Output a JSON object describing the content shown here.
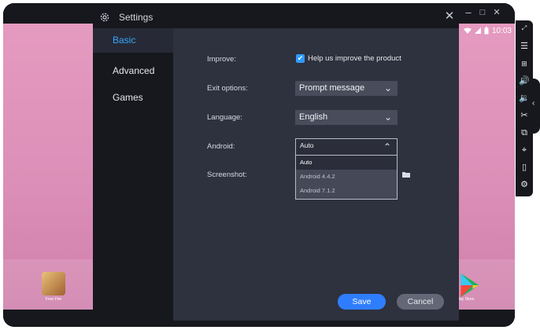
{
  "window": {
    "minimize_glyph": "–",
    "maximize_glyph": "□",
    "close_glyph": "✕"
  },
  "android": {
    "clock": "10:03",
    "apps": [
      {
        "label": "Free Fire"
      },
      {
        "label": "Play Store"
      }
    ]
  },
  "dialog": {
    "title": "Settings",
    "close_glyph": "✕",
    "nav": [
      {
        "label": "Basic",
        "active": true
      },
      {
        "label": "Advanced",
        "active": false
      },
      {
        "label": "Games",
        "active": false
      }
    ],
    "improve": {
      "label": "Improve:",
      "checkbox_label": "Help us improve the product",
      "checked": true
    },
    "exit_options": {
      "label": "Exit options:",
      "value": "Prompt message"
    },
    "language": {
      "label": "Language:",
      "value": "English"
    },
    "android_version": {
      "label": "Android:",
      "value": "Auto",
      "options": [
        "Auto",
        "Android 4.4.2",
        "Android 7.1.2"
      ]
    },
    "screenshot": {
      "label": "Screenshot:"
    },
    "save_label": "Save",
    "cancel_label": "Cancel"
  },
  "colors": {
    "accent": "#2f7dff",
    "nav_active": "#35a6ff",
    "dialog_bg": "#2e313e",
    "chrome_bg": "#17181d"
  }
}
